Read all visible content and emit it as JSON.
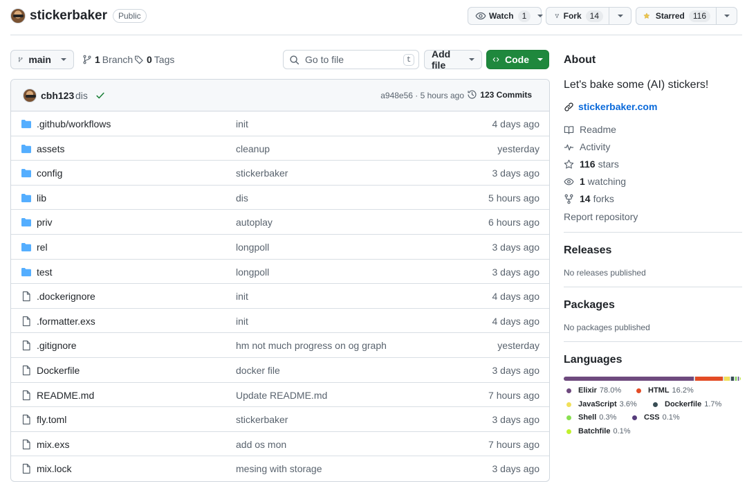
{
  "repo": {
    "name": "stickerbaker",
    "visibility": "Public",
    "watch_label": "Watch",
    "watch_count": "1",
    "fork_label": "Fork",
    "fork_count": "14",
    "star_label": "Starred",
    "star_count": "116"
  },
  "toolbar": {
    "branch": "main",
    "branch_count": "1",
    "branch_label": "Branch",
    "tag_count": "0",
    "tag_label": "Tags",
    "goto_placeholder": "Go to file",
    "goto_shortcut": "t",
    "add_file_label": "Add file",
    "code_label": "Code"
  },
  "commit": {
    "author": "cbh123",
    "message": "dis",
    "meta": "a948e56 · 5 hours ago",
    "count_label": "123 Commits"
  },
  "files": [
    {
      "type": "dir",
      "name": ".github/workflows",
      "commit": "init",
      "time": "4 days ago"
    },
    {
      "type": "dir",
      "name": "assets",
      "commit": "cleanup",
      "time": "yesterday"
    },
    {
      "type": "dir",
      "name": "config",
      "commit": "stickerbaker",
      "time": "3 days ago"
    },
    {
      "type": "dir",
      "name": "lib",
      "commit": "dis",
      "time": "5 hours ago"
    },
    {
      "type": "dir",
      "name": "priv",
      "commit": "autoplay",
      "time": "6 hours ago"
    },
    {
      "type": "dir",
      "name": "rel",
      "commit": "longpoll",
      "time": "3 days ago"
    },
    {
      "type": "dir",
      "name": "test",
      "commit": "longpoll",
      "time": "3 days ago"
    },
    {
      "type": "file",
      "name": ".dockerignore",
      "commit": "init",
      "time": "4 days ago"
    },
    {
      "type": "file",
      "name": ".formatter.exs",
      "commit": "init",
      "time": "4 days ago"
    },
    {
      "type": "file",
      "name": ".gitignore",
      "commit": "hm not much progress on og graph",
      "time": "yesterday"
    },
    {
      "type": "file",
      "name": "Dockerfile",
      "commit": "docker file",
      "time": "3 days ago"
    },
    {
      "type": "file",
      "name": "README.md",
      "commit": "Update README.md",
      "time": "7 hours ago"
    },
    {
      "type": "file",
      "name": "fly.toml",
      "commit": "stickerbaker",
      "time": "3 days ago"
    },
    {
      "type": "file",
      "name": "mix.exs",
      "commit": "add os mon",
      "time": "7 hours ago"
    },
    {
      "type": "file",
      "name": "mix.lock",
      "commit": "mesing with storage",
      "time": "3 days ago"
    }
  ],
  "about": {
    "heading": "About",
    "description": "Let's bake some (AI) stickers!",
    "website": "stickerbaker.com",
    "readme": "Readme",
    "activity": "Activity",
    "stars_count": "116",
    "stars_label": "stars",
    "watching_count": "1",
    "watching_label": "watching",
    "forks_count": "14",
    "forks_label": "forks",
    "report": "Report repository"
  },
  "releases": {
    "heading": "Releases",
    "note": "No releases published"
  },
  "packages": {
    "heading": "Packages",
    "note": "No packages published"
  },
  "languages": {
    "heading": "Languages",
    "items": [
      {
        "name": "Elixir",
        "percent": "78.0%",
        "share": 78.0,
        "color": "#6e4a7e"
      },
      {
        "name": "HTML",
        "percent": "16.2%",
        "share": 16.2,
        "color": "#e34c26"
      },
      {
        "name": "JavaScript",
        "percent": "3.6%",
        "share": 3.6,
        "color": "#f1e05a"
      },
      {
        "name": "Dockerfile",
        "percent": "1.7%",
        "share": 1.7,
        "color": "#384d54"
      },
      {
        "name": "Shell",
        "percent": "0.3%",
        "share": 0.3,
        "color": "#89e051"
      },
      {
        "name": "CSS",
        "percent": "0.1%",
        "share": 0.1,
        "color": "#563d7c"
      },
      {
        "name": "Batchfile",
        "percent": "0.1%",
        "share": 0.1,
        "color": "#c1f12e"
      }
    ]
  },
  "icons": {
    "folder": "folder-icon",
    "file": "file-icon",
    "accent": "#1f883d",
    "link": "#0969da",
    "folder_color": "#54aeff"
  }
}
